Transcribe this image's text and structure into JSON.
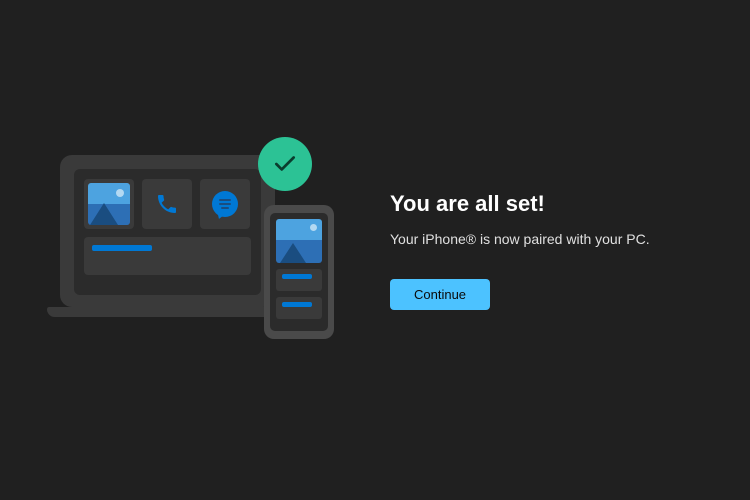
{
  "heading": "You are all set!",
  "subtext": "Your iPhone® is now paired with your PC.",
  "continue_label": "Continue",
  "colors": {
    "background": "#202020",
    "accent": "#4cc2ff",
    "success": "#2cc295"
  }
}
